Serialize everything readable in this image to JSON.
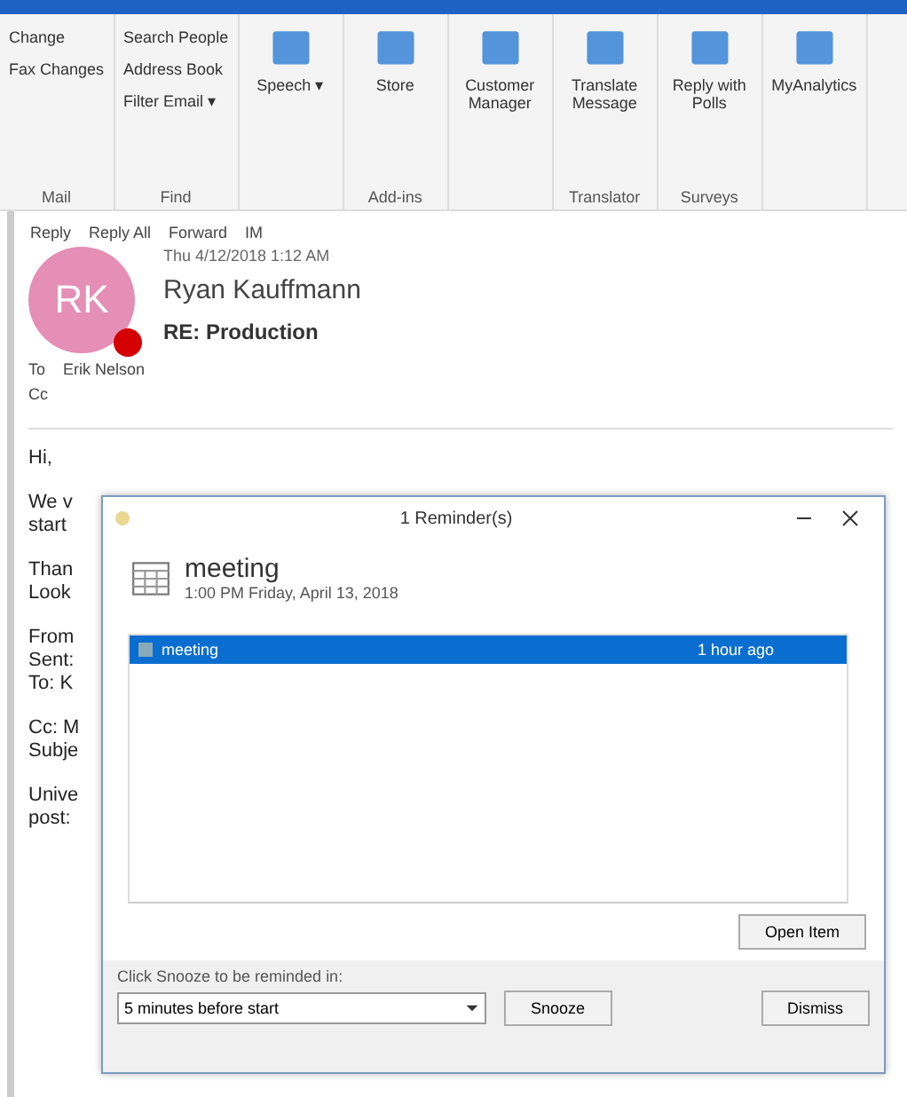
{
  "ribbon": {
    "groups": [
      {
        "kind": "list",
        "items": [
          "Change",
          "Fax Changes"
        ],
        "label": "Mail"
      },
      {
        "kind": "list",
        "items": [
          "Search People",
          "Address Book",
          "Filter Email ▾"
        ],
        "label": "Find"
      },
      {
        "kind": "big",
        "items": [
          "Speech ▾"
        ]
      },
      {
        "kind": "big",
        "items": [
          "Store"
        ],
        "label": "Add-ins"
      },
      {
        "kind": "big",
        "items": [
          "Customer Manager"
        ]
      },
      {
        "kind": "big",
        "items": [
          "Translate Message"
        ],
        "label": "Translator"
      },
      {
        "kind": "big",
        "items": [
          "Reply with Polls"
        ],
        "label": "Surveys"
      },
      {
        "kind": "big",
        "items": [
          "MyAnalytics"
        ]
      }
    ]
  },
  "message": {
    "actions": [
      "Reply",
      "Reply All",
      "Forward",
      "IM"
    ],
    "date": "Thu 4/12/2018 1:12 AM",
    "initials": "RK",
    "sender": "Ryan Kauffmann",
    "subject": "RE: Production",
    "to_label": "To",
    "to": "Erik Nelson",
    "cc_label": "Cc",
    "body": [
      "Hi,",
      "We v",
      "start",
      "Than",
      "Look",
      "From",
      "Sent:",
      "To: K",
      "Cc: M",
      "Subje",
      "Unive",
      "post:"
    ]
  },
  "reminder": {
    "title": "1 Reminder(s)",
    "item_title": "meeting",
    "item_time": "1:00 PM Friday, April 13, 2018",
    "rows": [
      {
        "subject": "meeting",
        "due": "1 hour ago",
        "selected": true
      }
    ],
    "open_button": "Open Item",
    "snooze_label": "Click Snooze to be reminded in:",
    "snooze_value": "5 minutes before start",
    "snooze_button": "Snooze",
    "dismiss_button": "Dismiss"
  }
}
